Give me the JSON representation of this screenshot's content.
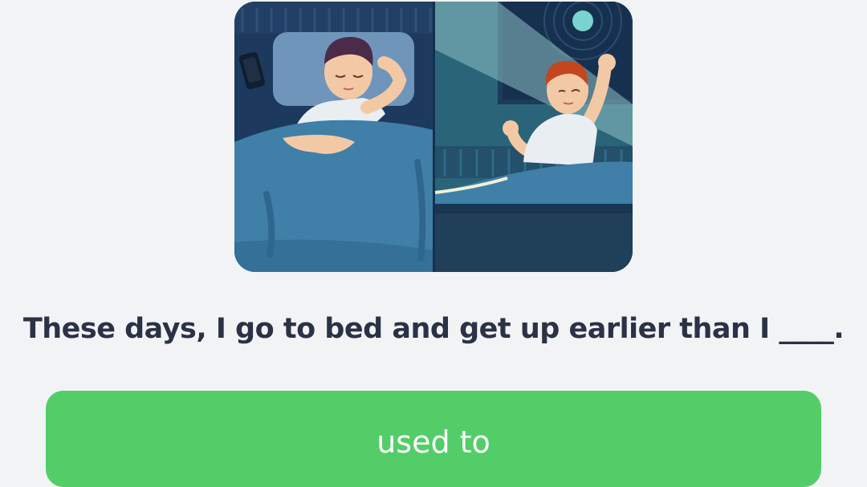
{
  "question": {
    "text": "These days, I go to bed and get up earlier than I ____."
  },
  "answer_option": {
    "label": "used to",
    "color": "#53cd68"
  },
  "illustration": {
    "icon": "sleeping-and-waking-man-illustration"
  }
}
